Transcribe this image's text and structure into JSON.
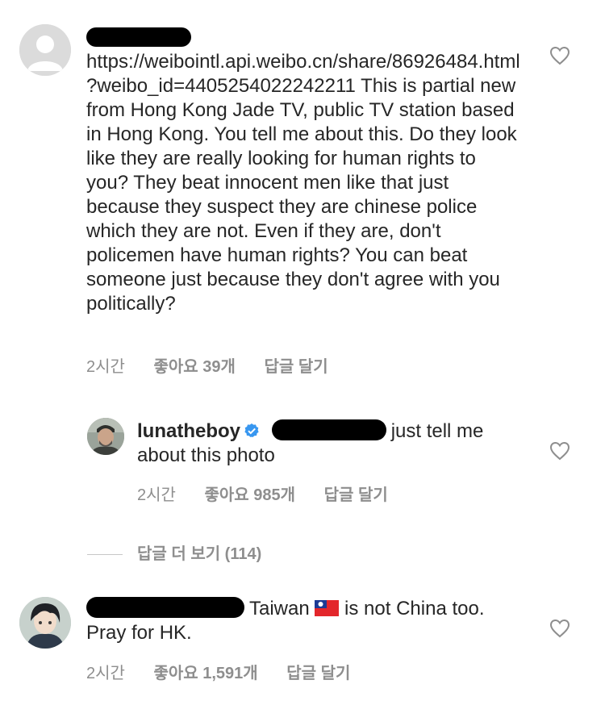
{
  "comments": [
    {
      "text": "https://weibointl.api.weibo.cn/share/86926484.html?weibo_id=4405254022242211  This is partial new from Hong Kong Jade TV, public TV station based in Hong Kong. You tell me about this. Do they look like they are really looking for human rights to you? They beat innocent men like that just because they suspect they are chinese police which they are not.  Even if they are,  don't policemen have human rights? You can beat someone just because they don't agree with you politically?",
      "time": "2시간",
      "likes": "좋아요 39개",
      "reply": "답글 달기"
    },
    {
      "username": "lunatheboy",
      "text_line1": "just tell me",
      "text_line2": "about this photo",
      "time": "2시간",
      "likes": "좋아요 985개",
      "reply": "답글 달기"
    },
    {
      "text_part1": "Taiwan",
      "text_part2": " is not China too.",
      "text_part3": "Pray for HK.",
      "time": "2시간",
      "likes": "좋아요 1,591개",
      "reply": "답글 달기"
    }
  ],
  "view_replies": "답글 더 보기 (114)",
  "icons": {
    "heart": "heart-outline-icon",
    "verified": "verified-badge-icon",
    "flag": "taiwan-flag-icon"
  },
  "colors": {
    "text": "#262626",
    "meta": "#8e8e8e",
    "verified": "#3897f0"
  }
}
